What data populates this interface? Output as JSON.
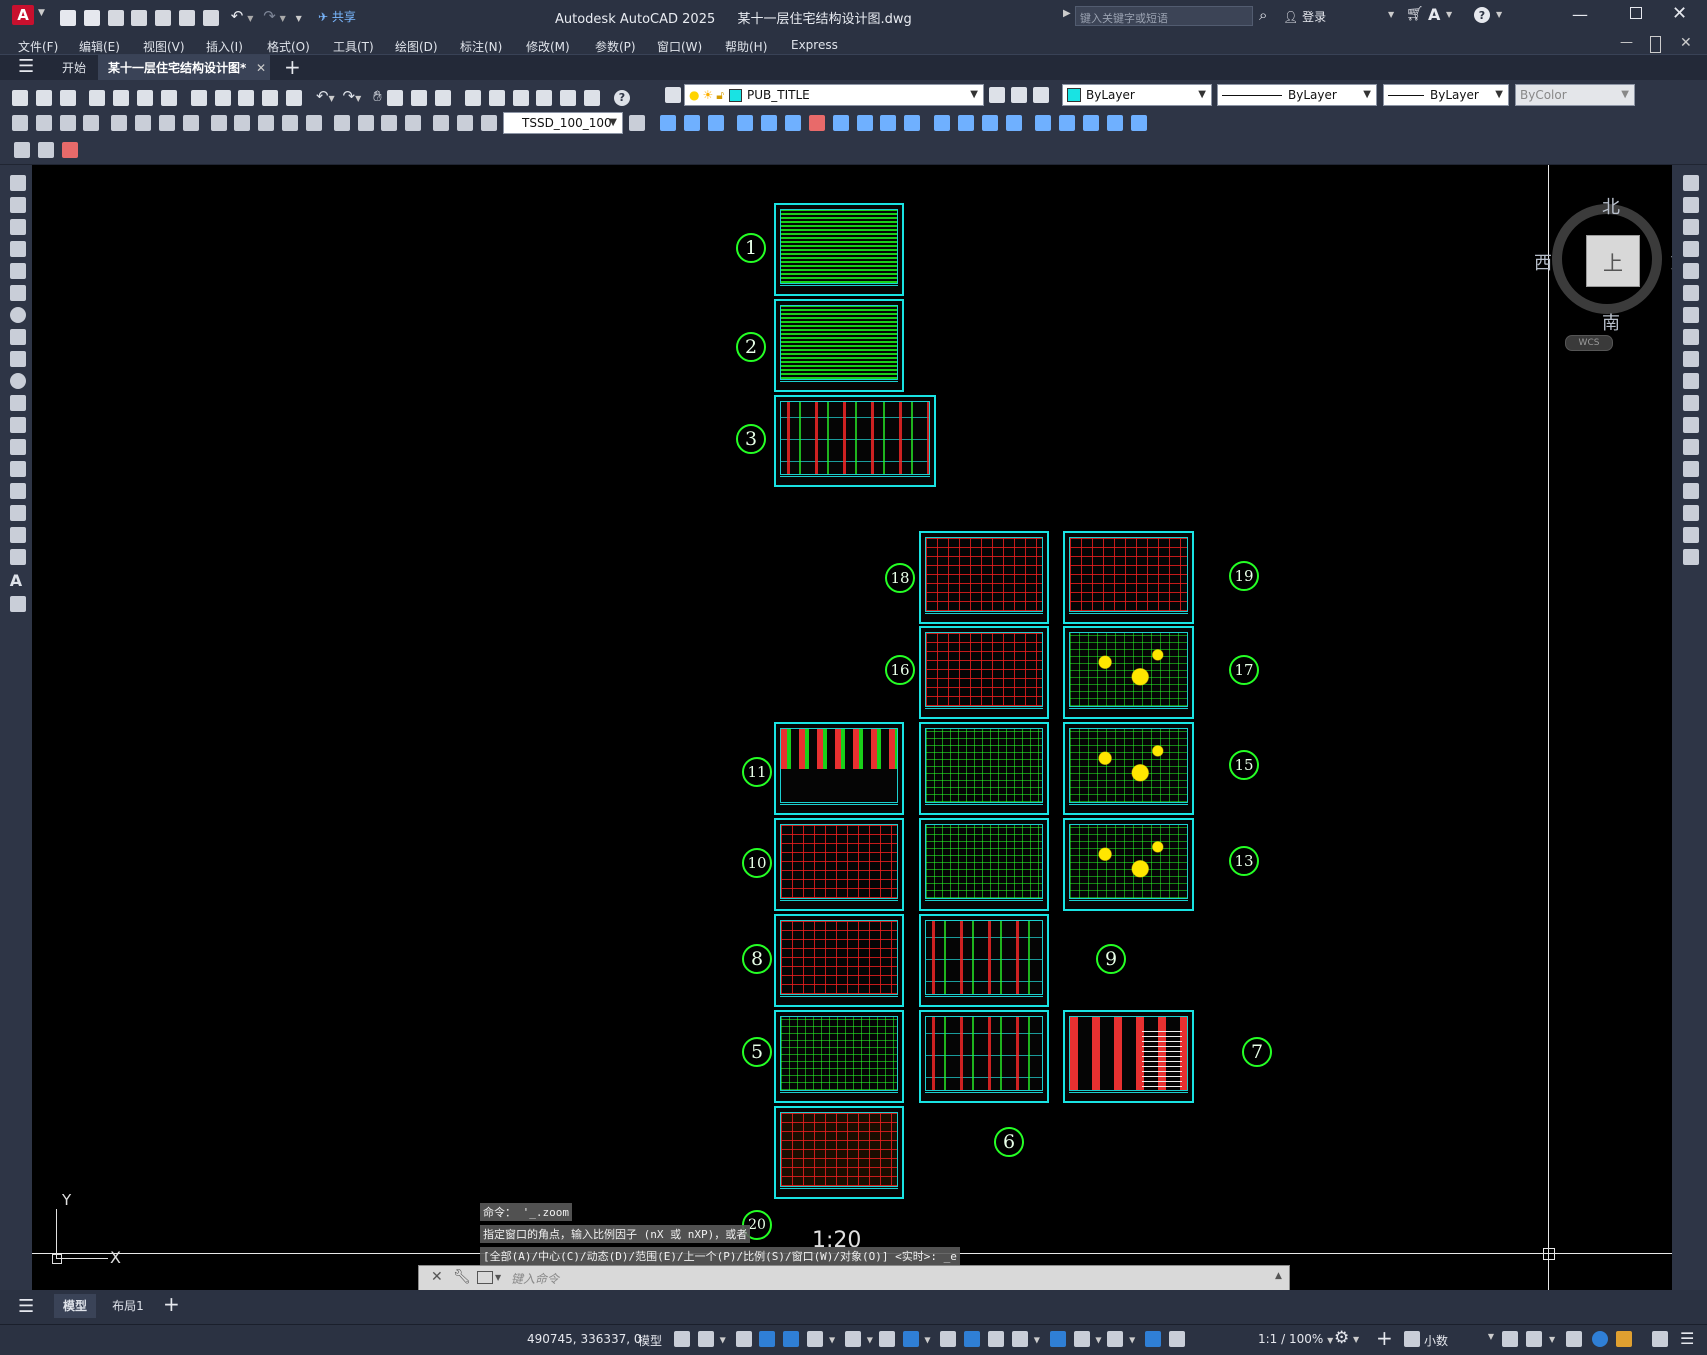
{
  "app": {
    "title": "Autodesk AutoCAD 2025",
    "document": "某十一层住宅结构设计图.dwg",
    "logo_letter": "A",
    "share_label": "共享",
    "search_placeholder": "键入关键字或短语",
    "login_label": "登录"
  },
  "menu": [
    "文件(F)",
    "编辑(E)",
    "视图(V)",
    "插入(I)",
    "格式(O)",
    "工具(T)",
    "绘图(D)",
    "标注(N)",
    "修改(M)",
    "参数(P)",
    "窗口(W)",
    "帮助(H)",
    "Express"
  ],
  "tabs": {
    "start": "开始",
    "active_doc": "某十一层住宅结构设计图*"
  },
  "toolbar": {
    "layer_name": "PUB_TITLE",
    "color_value": "ByLayer",
    "linetype_value": "ByLayer",
    "lineweight_value": "ByLayer",
    "plotstyle_value": "ByColor",
    "dimstyle_value": "TSSD_100_100"
  },
  "viewcube": {
    "north": "北",
    "south": "南",
    "east": "东",
    "west": "西",
    "face": "上",
    "wcs": "WCS"
  },
  "ucs": {
    "x_label": "X",
    "y_label": "Y"
  },
  "drawing": {
    "sheet_numbers": [
      "1",
      "2",
      "3",
      "18",
      "19",
      "16",
      "17",
      "11",
      "15",
      "10",
      "13",
      "8",
      "9",
      "5",
      "7",
      "6",
      "20"
    ],
    "scale_text": "1:20"
  },
  "command_history": [
    "命令： '_.zoom",
    "指定窗口的角点，输入比例因子 (nX 或 nXP)，或者",
    "[全部(A)/中心(C)/动态(D)/范围(E)/上一个(P)/比例(S)/窗口(W)/对象(O)] <实时>: _e"
  ],
  "command_input_placeholder": "键入命令",
  "layout_tabs": {
    "model": "模型",
    "layout1": "布局1"
  },
  "status": {
    "coordinates": "490745, 336337, 0",
    "model_label": "模型",
    "annotation_scale": "1:1 / 100%",
    "units": "小数"
  },
  "colors": {
    "canvas": "#000000",
    "sheet_frame": "#19e3e3",
    "number_circle": "#25ff25",
    "ui_dark": "#2b3242"
  }
}
